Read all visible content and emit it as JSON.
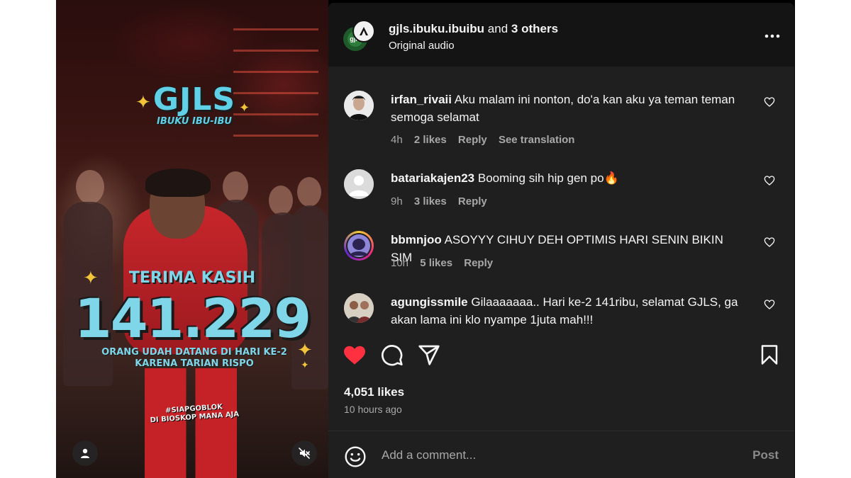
{
  "post": {
    "author": "gjls.ibuku.ibuibu",
    "coauthors_text": "and",
    "coauthors_count": "3 others",
    "audio": "Original audio",
    "more_icon": "more-horizontal-icon",
    "author_avatar_text": "gjls"
  },
  "video": {
    "logo_title": "GJLS",
    "logo_subtitle": "IBUKU IBU-IBU",
    "thanks": "TERIMA KASIH",
    "count": "141.229",
    "caption_line1": "ORANG UDAH DATANG DI HARI KE-2",
    "caption_line2": "KARENA TARIAN RISPO",
    "tagline_line1": "#SIAPGOBLOK",
    "tagline_line2": "DI BIOSKOP MANA AJA",
    "user_icon": "user-icon",
    "mute_icon": "muted-speaker-icon"
  },
  "comments": [
    {
      "user": "irfan_rivaii",
      "text": "Aku malam ini nonton, do'a kan aku ya teman teman semoga selamat",
      "time": "4h",
      "likes": "2 likes",
      "reply": "Reply",
      "translate": "See translation"
    },
    {
      "user": "batariakajen23",
      "text": "Booming sih hip gen po🔥",
      "time": "9h",
      "likes": "3 likes",
      "reply": "Reply"
    },
    {
      "user": "bbmnjoo",
      "text": "ASOYYY CIHUY DEH OPTIMIS HARI SENIN BIKIN SIM",
      "time": "10h",
      "likes": "5 likes",
      "reply": "Reply"
    },
    {
      "user": "agungissmile",
      "text": "Gilaaaaaaa.. Hari ke-2 141ribu, selamat GJLS, ga akan lama ini klo nyampe 1juta mah!!!",
      "time": "",
      "likes": "",
      "reply": ""
    }
  ],
  "footer": {
    "likes": "4,051 likes",
    "time": "10 hours ago",
    "add_comment_placeholder": "Add a comment...",
    "post_label": "Post"
  },
  "colors": {
    "panel_bg": "#1f1f1f",
    "header_bg": "#141414",
    "like_red": "#ff3040",
    "muted_text": "#a8a8a8",
    "poster_cyan": "#7fd6e8"
  }
}
